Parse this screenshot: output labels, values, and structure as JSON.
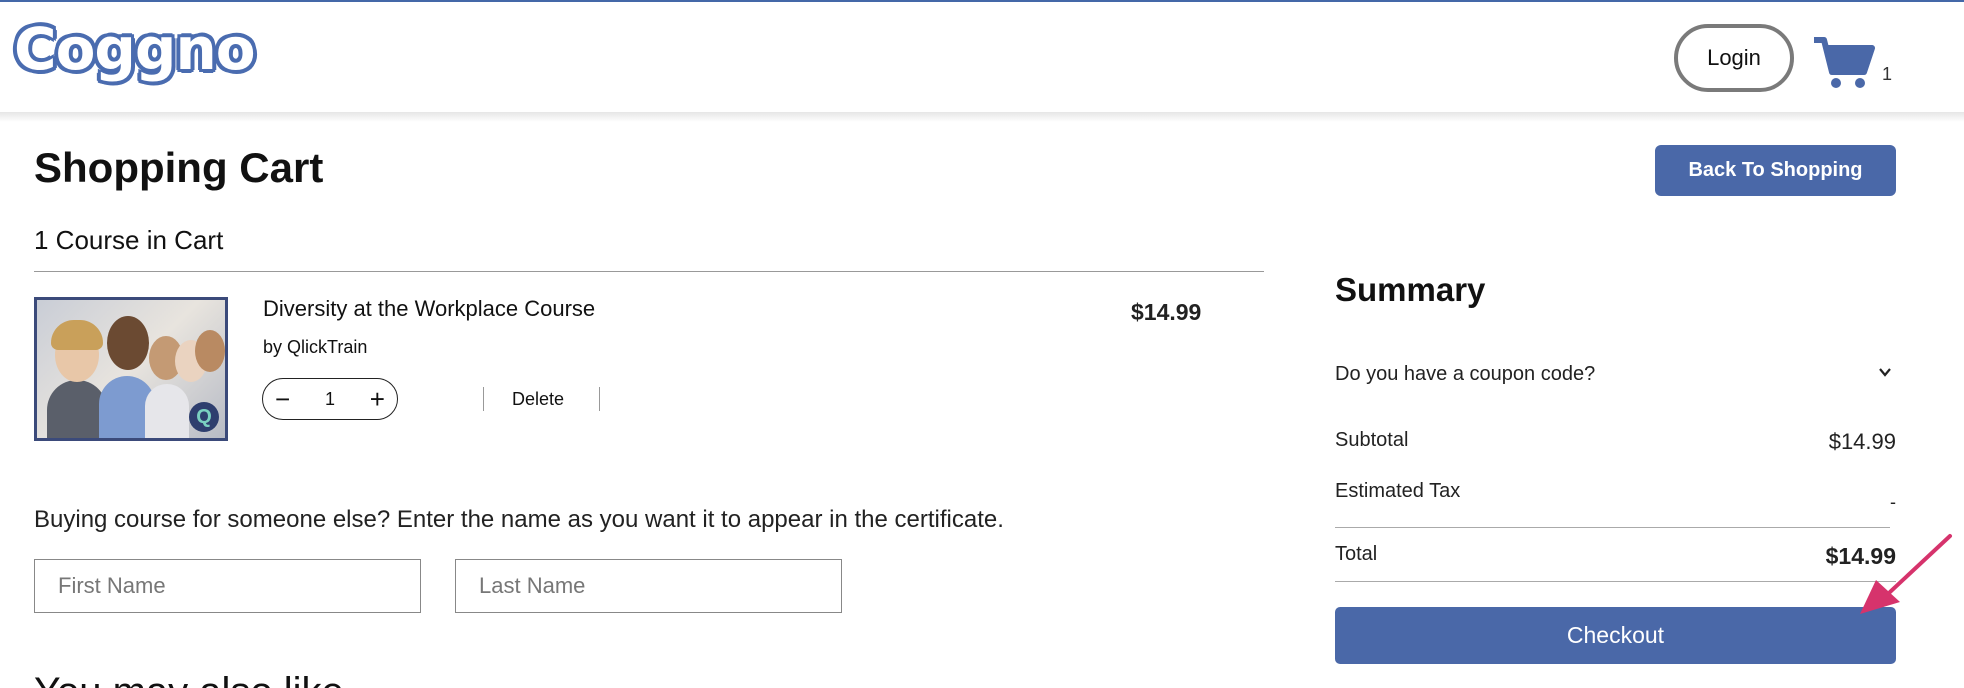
{
  "header": {
    "logo_text": "Coggno",
    "login_label": "Login",
    "cart_count": "1"
  },
  "cart": {
    "title": "Shopping Cart",
    "back_label": "Back To Shopping",
    "count_label": "1 Course in Cart",
    "item": {
      "title": "Diversity at the Workplace Course",
      "by": "by QlickTrain",
      "quantity": "1",
      "minus": "−",
      "plus": "+",
      "delete_label": "Delete",
      "price": "$14.99",
      "badge": "Q"
    },
    "gift_prompt": "Buying course for someone else? Enter the name as you want it to appear in the certificate.",
    "first_name_placeholder": "First Name",
    "last_name_placeholder": "Last Name",
    "cutoff_text": "You may also like"
  },
  "summary": {
    "title": "Summary",
    "coupon_label": "Do you have a coupon code?",
    "subtotal_label": "Subtotal",
    "subtotal_value": "$14.99",
    "tax_label": "Estimated Tax",
    "tax_value": "-",
    "total_label": "Total",
    "total_value": "$14.99",
    "checkout_label": "Checkout"
  },
  "colors": {
    "brand": "#4a68a8",
    "annotation_arrow": "#d6336c"
  },
  "icons": {
    "cart": "shopping-cart-icon",
    "chevron": "chevron-down-icon",
    "arrow": "annotation-arrow"
  }
}
